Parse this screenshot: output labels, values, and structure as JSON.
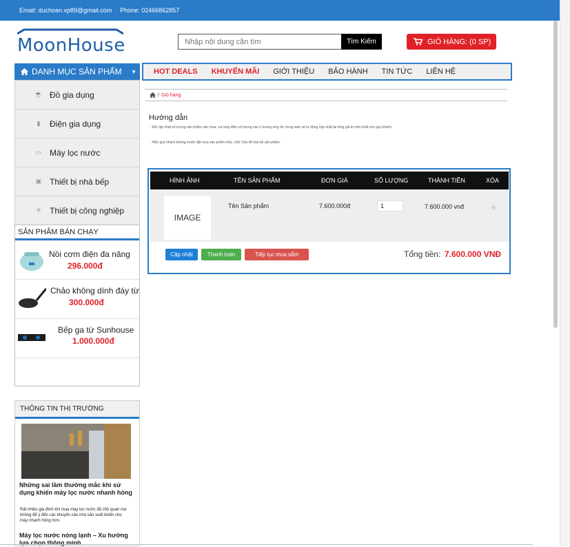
{
  "topbar": {
    "email": "Email: duchoan.vp89@gmail.com",
    "phone": "Phone: 02466862857"
  },
  "logo": {
    "text": "MoonHouse"
  },
  "search": {
    "placeholder": "Nhập nội dung cần tìm",
    "button": "Tìm Kiếm"
  },
  "cart": {
    "label": "GIỎ HÀNG: (0 SP)"
  },
  "category": {
    "title": "DANH MỤC SẢN PHẨM",
    "items": [
      {
        "label": "Đồ gia dụng"
      },
      {
        "label": "Điện gia dụng"
      },
      {
        "label": "Máy lọc nước"
      },
      {
        "label": "Thiết bị nhà bếp"
      },
      {
        "label": "Thiết bị công nghiệp"
      }
    ]
  },
  "nav": {
    "items": [
      {
        "label": "HOT DEALS"
      },
      {
        "label": "KHUYẾN MÃI"
      },
      {
        "label": "GIỚI THIỆU"
      },
      {
        "label": "BẢO HÀNH"
      },
      {
        "label": "TIN TỨC"
      },
      {
        "label": "LIÊN HỆ"
      }
    ]
  },
  "bestsellers": {
    "title": "SẢN PHẨM BÁN CHẠY",
    "items": [
      {
        "name": "Nồi cơm điện đa năng",
        "price": "296.000đ"
      },
      {
        "name": "Chảo không dính đáy từ",
        "price": "300.000đ"
      },
      {
        "name": "Bếp ga từ Sunhouse",
        "price": "1.000.000đ"
      }
    ]
  },
  "market": {
    "title": "THÔNG TIN THỊ TRƯỜNG",
    "article1_title": "Những sai lầm thường mắc khi sử dụng khiến máy lọc nước nhanh hỏng",
    "article1_desc": "Rất nhiều gia đình khi mua máy lọc nước đã chủ quan mà không để ý đến các khuyến cáo nhà sản xuất khiến cho máy nhanh hỏng hơn.",
    "article2_title": "Máy lọc nước nóng lạnh – Xu hướng lựa chọn thông minh"
  },
  "breadcrumb": {
    "separator": "/",
    "current": "Giỏ hàng"
  },
  "guide": {
    "title": "Hướng dẫn",
    "line1": "- Để cập nhật số lượng sản phẩm cần mua, vui lòng điền số lượng vào ô tương ứng rồi, trong web sẽ tự động cập nhật lại tổng giá trị mới nhất cho quý khách.",
    "line2": "- Nếu quý khách không muốn đặt mua sản phẩm nữa, click Xóa để loại bỏ sản phẩm."
  },
  "table": {
    "headers": [
      "HÌNH ẢNH",
      "TÊN SẢN PHẨM",
      "ĐƠN GIÁ",
      "SỐ LƯỢNG",
      "THÀNH TIỀN",
      "XÓA"
    ],
    "row": {
      "image": "IMAGE",
      "name": "Tên Sản phẩm",
      "price": "7.600.000đ",
      "qty": "1",
      "total": "7.600.000 vnđ"
    }
  },
  "actions": {
    "update": "Cập nhật",
    "checkout": "Thanh toán",
    "continue": "Tiếp tục mua sắm"
  },
  "summary": {
    "label": "Tổng tiền:",
    "value": "7.600.000 VNĐ"
  },
  "colors": {
    "primary": "#2a7bc8",
    "accent": "#e02127",
    "green": "#4cae4c"
  }
}
